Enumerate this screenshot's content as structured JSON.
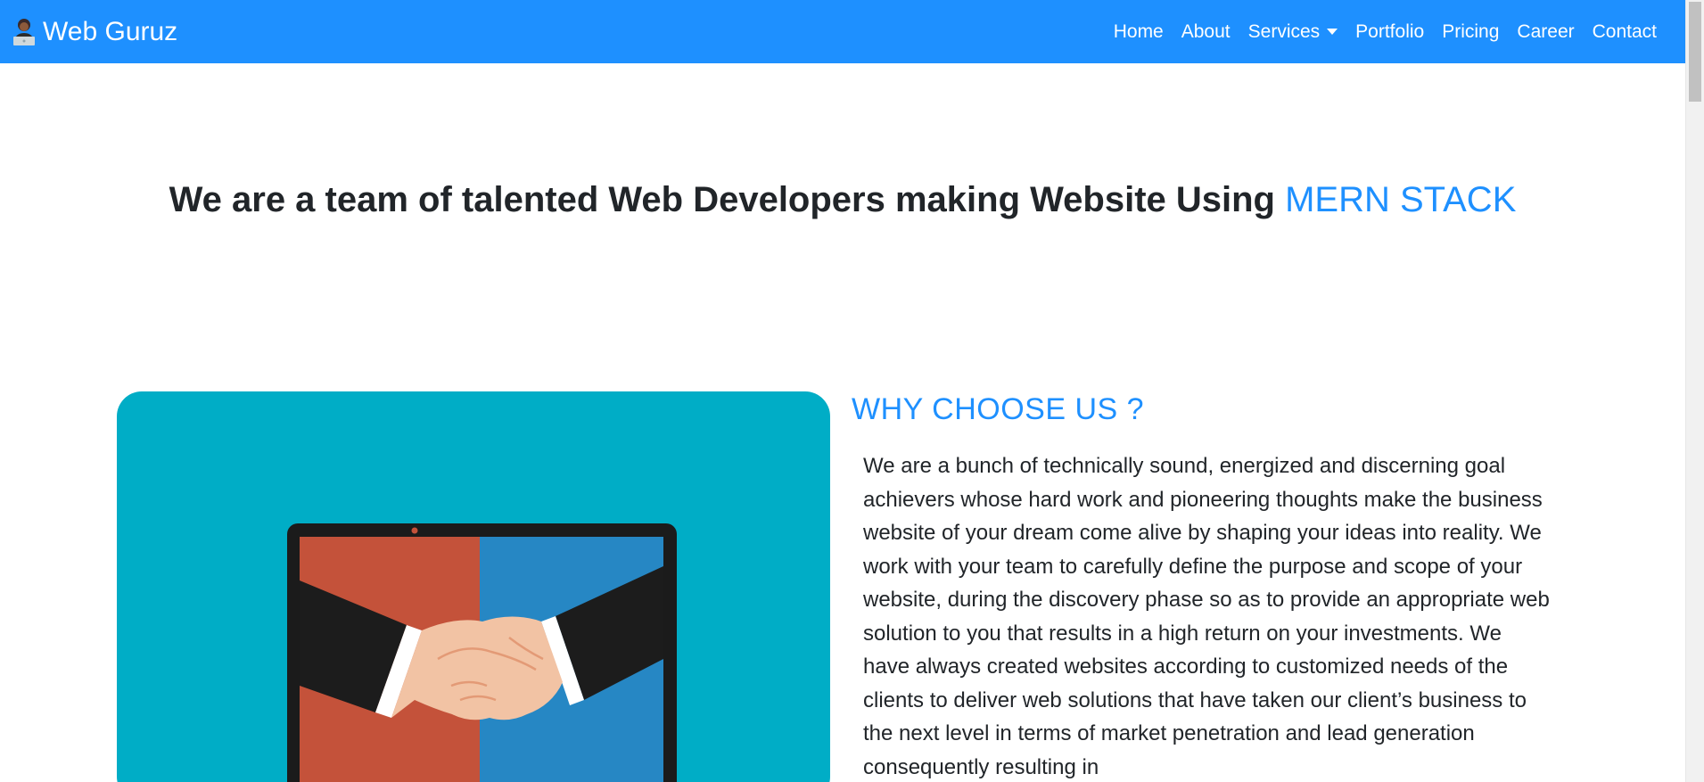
{
  "navbar": {
    "brand": "Web Guruz",
    "links": [
      {
        "label": "Home"
      },
      {
        "label": "About"
      },
      {
        "label": "Services"
      },
      {
        "label": "Portfolio"
      },
      {
        "label": "Pricing"
      },
      {
        "label": "Career"
      },
      {
        "label": "Contact"
      }
    ],
    "color": "#1e90ff"
  },
  "hero": {
    "title_prefix": "We are a team of talented Web Developers making Website Using ",
    "title_accent": "MERN STACK",
    "accent_color": "#1e90ff"
  },
  "about": {
    "image_icon": "handshake-laptop-illustration",
    "image_bg_color": "#00adc6",
    "heading": "WHY CHOOSE US ?",
    "body": "We are a bunch of technically sound, energized and discerning goal achievers whose hard work and pioneering thoughts make the business website of your dream come alive by shaping your ideas into reality. We work with your team to carefully define the purpose and scope of your website, during the discovery phase so as to provide an appropriate web solution to you that results in a high return on your investments. We have always created websites according to customized needs of the clients to deliver web solutions that have taken our client’s business to the next level in terms of market penetration and lead generation consequently resulting in"
  }
}
